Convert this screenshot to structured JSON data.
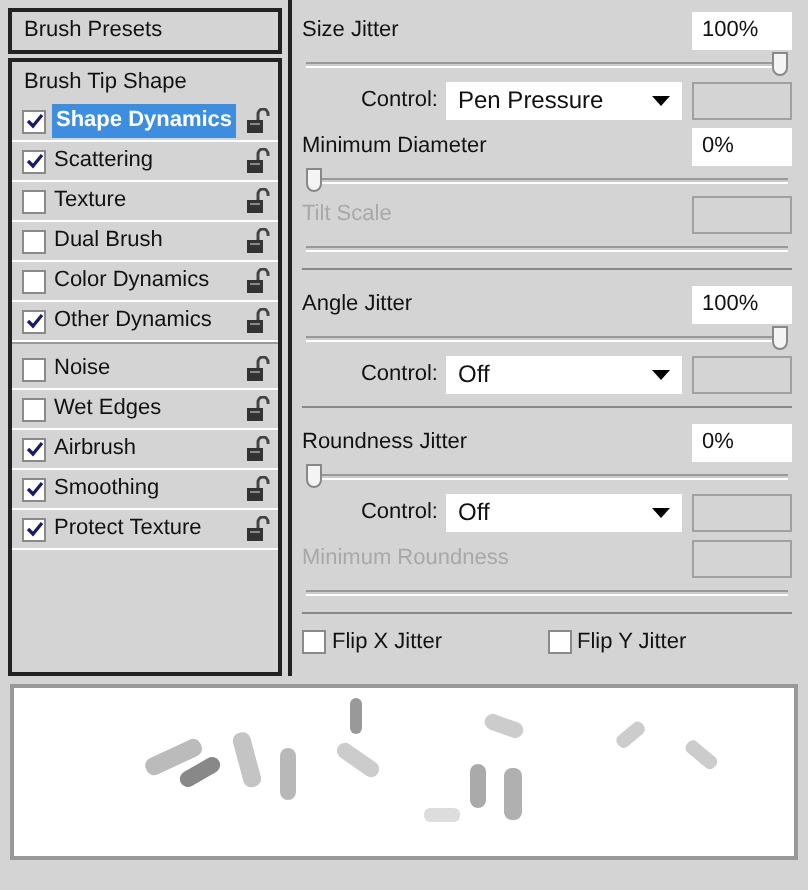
{
  "sidebar": {
    "header": "Brush Presets",
    "tip_shape": "Brush Tip Shape",
    "groups": [
      {
        "items": [
          {
            "label": "Shape Dynamics",
            "checked": true,
            "selected": true
          },
          {
            "label": "Scattering",
            "checked": true,
            "selected": false
          },
          {
            "label": "Texture",
            "checked": false,
            "selected": false
          },
          {
            "label": "Dual Brush",
            "checked": false,
            "selected": false
          },
          {
            "label": "Color Dynamics",
            "checked": false,
            "selected": false
          },
          {
            "label": "Other Dynamics",
            "checked": true,
            "selected": false
          }
        ]
      },
      {
        "items": [
          {
            "label": "Noise",
            "checked": false,
            "selected": false
          },
          {
            "label": "Wet Edges",
            "checked": false,
            "selected": false
          },
          {
            "label": "Airbrush",
            "checked": true,
            "selected": false
          },
          {
            "label": "Smoothing",
            "checked": true,
            "selected": false
          },
          {
            "label": "Protect Texture",
            "checked": true,
            "selected": false
          }
        ]
      }
    ]
  },
  "sections": [
    {
      "rows": [
        {
          "kind": "slider",
          "label": "Size Jitter",
          "value": "100%",
          "level": 1,
          "disabled": false
        },
        {
          "kind": "control",
          "label": "Control:",
          "value": "Pen Pressure"
        },
        {
          "kind": "slider",
          "label": "Minimum Diameter",
          "value": "0%",
          "level": 0,
          "disabled": false
        },
        {
          "kind": "slider",
          "label": "Tilt Scale",
          "disabled": true
        }
      ]
    },
    {
      "rows": [
        {
          "kind": "slider",
          "label": "Angle Jitter",
          "value": "100%",
          "level": 1,
          "disabled": false
        },
        {
          "kind": "control",
          "label": "Control:",
          "value": "Off"
        }
      ]
    },
    {
      "rows": [
        {
          "kind": "slider",
          "label": "Roundness Jitter",
          "value": "0%",
          "level": 0,
          "disabled": false
        },
        {
          "kind": "control",
          "label": "Control:",
          "value": "Off"
        },
        {
          "kind": "slider",
          "label": "Minimum Roundness",
          "disabled": true
        }
      ]
    }
  ],
  "flips": [
    {
      "label": "Flip X Jitter",
      "checked": false
    },
    {
      "label": "Flip Y Jitter",
      "checked": false
    }
  ]
}
